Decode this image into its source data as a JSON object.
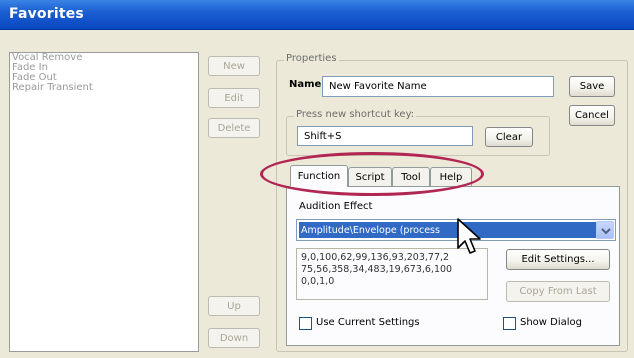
{
  "window": {
    "title": "Favorites"
  },
  "favorites_list": {
    "items": [
      "Vocal Remove",
      "Fade In",
      "Fade Out",
      "Repair Transient"
    ]
  },
  "left_buttons": {
    "new": "New",
    "edit": "Edit",
    "delete": "Delete",
    "up": "Up",
    "down": "Down"
  },
  "properties": {
    "group_label": "Properties",
    "name_label": "Name",
    "name_value": "New Favorite Name",
    "save": "Save",
    "cancel": "Cancel",
    "shortcut_group_label": "Press new shortcut key:",
    "shortcut_value": "Shift+S",
    "clear": "Clear"
  },
  "tabs": [
    {
      "label": "Function",
      "active": true
    },
    {
      "label": "Script",
      "active": false
    },
    {
      "label": "Tool",
      "active": false
    },
    {
      "label": "Help",
      "active": false
    }
  ],
  "function_tab": {
    "effect_label": "Audition Effect",
    "effect_selected": "Amplitude\\Envelope (process",
    "params_text": "9,0,100,62,99,136,93,203,77,2\n75,56,358,34,483,19,673,6,100\n0,0,1,0",
    "edit_settings": "Edit Settings...",
    "copy_from_last": "Copy From Last",
    "use_current_settings": "Use Current Settings",
    "show_dialog": "Show Dialog"
  },
  "colors": {
    "accent": "#316ac5",
    "titlebar": "#1b5fd1",
    "highlight_ellipse": "#b22654"
  },
  "icons": {
    "dropdown": "chevron-down-icon",
    "cursor": "mouse-pointer-icon"
  }
}
